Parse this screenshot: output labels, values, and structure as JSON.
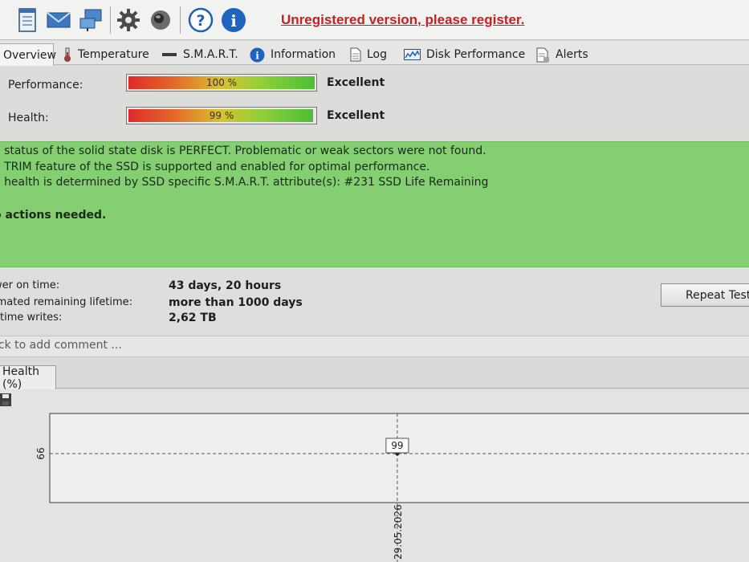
{
  "toolbar": {
    "icons": [
      "notepad-icon",
      "mail-icon",
      "network-icon",
      "gear-icon",
      "speaker-icon",
      "help-icon",
      "info-icon"
    ],
    "register_text": "Unregistered version, please register.",
    "register_color": "#c62020"
  },
  "tabs": [
    {
      "label": "Overview",
      "icon": "none",
      "active": true
    },
    {
      "label": "Temperature",
      "icon": "thermometer-icon"
    },
    {
      "label": "S.M.A.R.T.",
      "icon": "drive-icon"
    },
    {
      "label": "Information",
      "icon": "info-icon"
    },
    {
      "label": "Log",
      "icon": "document-icon"
    },
    {
      "label": "Disk Performance",
      "icon": "performance-chart-icon"
    },
    {
      "label": "Alerts",
      "icon": "alert-document-icon"
    }
  ],
  "meters": {
    "performance": {
      "label": "Performance:",
      "value_text": "100 %",
      "value": 100,
      "rating": "Excellent"
    },
    "health": {
      "label": "Health:",
      "value_text": "99 %",
      "value": 99,
      "rating": "Excellent"
    }
  },
  "status": {
    "color": "#83cf72",
    "lines": [
      "e status of the solid state disk is PERFECT. Problematic or weak sectors were not found.",
      "e TRIM feature of the SSD is supported and enabled for optimal performance.",
      "e health is determined by SSD specific S.M.A.R.T. attribute(s):  #231 SSD Life Remaining"
    ],
    "action": "o actions needed."
  },
  "info": {
    "power_on_label": "wer on time:",
    "power_on_value": "43 days, 20 hours",
    "lifetime_label": "imated remaining lifetime:",
    "lifetime_value": "more than 1000 days",
    "writes_label": "etime writes:",
    "writes_value": "2,62 TB",
    "repeat_button": "Repeat Test"
  },
  "comment_placeholder": "ick to add comment ...",
  "chart_tab_label": "Health (%)",
  "chart_data": {
    "type": "line",
    "x": [
      "29.05.2026"
    ],
    "series": [
      {
        "values": [
          99
        ]
      }
    ],
    "ytick_labels": [
      "99"
    ],
    "data_labels": [
      "99"
    ],
    "xlabel": "",
    "ylabel": "",
    "grid": true
  }
}
